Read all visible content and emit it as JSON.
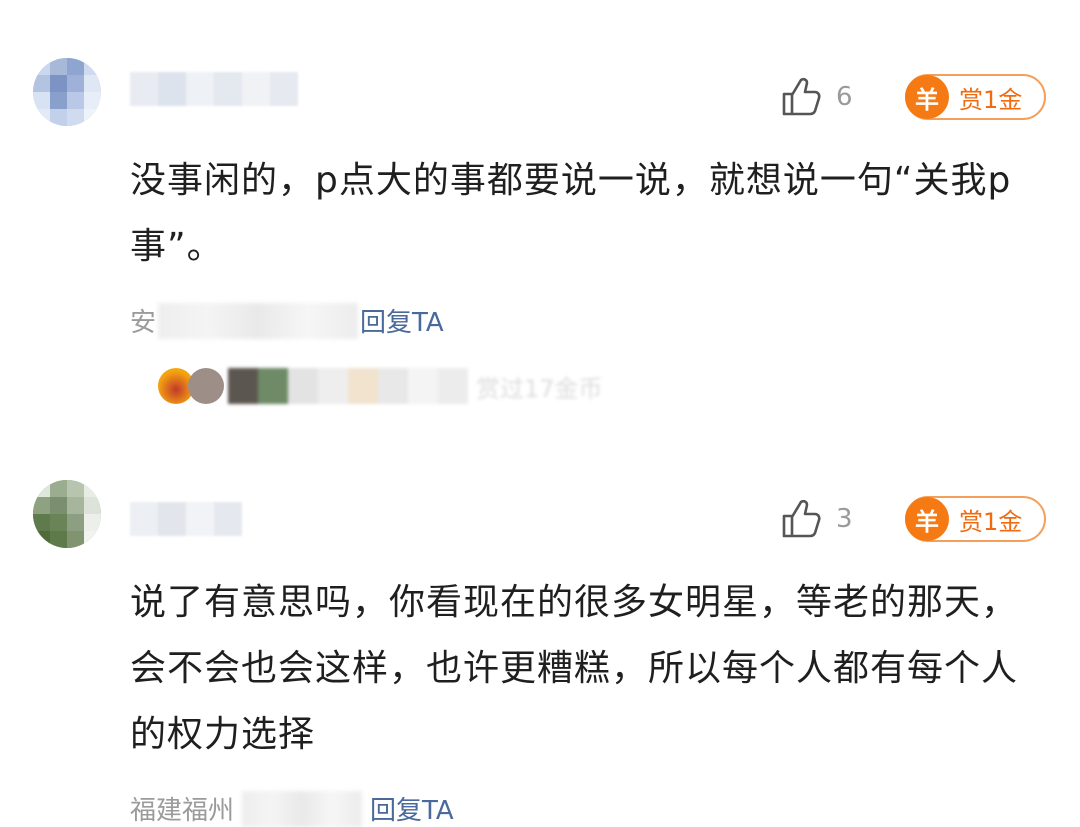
{
  "comments": [
    {
      "likes": "6",
      "reward_coin": "羊",
      "reward_label": "赏1金",
      "text": "没事闲的，p点大的事都要说一说，就想说一句“关我p事”。",
      "meta_prefix": "安",
      "reply_label": "回复TA",
      "reward_summary": "赏过17金币"
    },
    {
      "likes": "3",
      "reward_coin": "羊",
      "reward_label": "赏1金",
      "text": "说了有意思吗，你看现在的很多女明星，等老的那天，会不会也会这样，也许更糟糕，所以每个人都有每个人的权力选择",
      "meta_prefix": "福建福州",
      "reply_label": "回复TA"
    }
  ],
  "colors": {
    "accent": "#f57a14",
    "reply_link": "#4a6a9c",
    "muted": "#9b9b9b"
  },
  "icons": {
    "like": "thumbs-up-icon",
    "reward": "coin-icon"
  }
}
